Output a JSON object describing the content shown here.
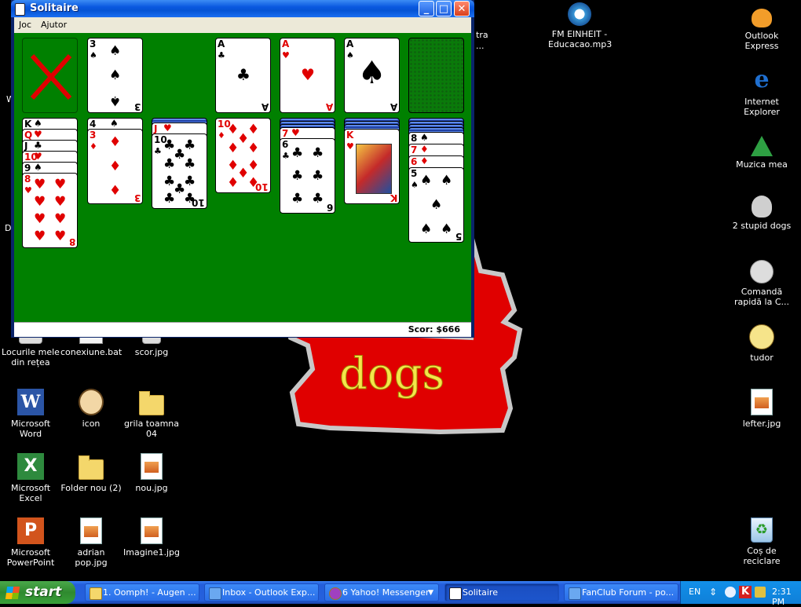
{
  "window": {
    "title": "Solitaire",
    "menu": [
      "Joc",
      "Ajutor"
    ],
    "status_score": "Scor: $666",
    "buttons": {
      "minimize": "_",
      "maximize": "□",
      "close": "✕"
    }
  },
  "game": {
    "stock": {
      "state": "empty",
      "mark": "red-x"
    },
    "waste_top": {
      "rank": "3",
      "suit": "♠"
    },
    "foundations": [
      {
        "rank": "A",
        "suit": "♣"
      },
      {
        "rank": "A",
        "suit": "♥"
      },
      {
        "rank": "A",
        "suit": "♠"
      },
      {
        "state": "empty"
      }
    ],
    "tableau": [
      {
        "face_down": 0,
        "face_up": [
          {
            "rank": "K",
            "suit": "♠"
          },
          {
            "rank": "Q",
            "suit": "♥"
          },
          {
            "rank": "J",
            "suit": "♣"
          },
          {
            "rank": "10",
            "suit": "♥"
          },
          {
            "rank": "9",
            "suit": "♠"
          },
          {
            "rank": "8",
            "suit": "♥"
          }
        ]
      },
      {
        "face_down": 0,
        "face_up": [
          {
            "rank": "4",
            "suit": "♠"
          },
          {
            "rank": "3",
            "suit": "♦"
          }
        ]
      },
      {
        "face_down": 1,
        "face_up": [
          {
            "rank": "J",
            "suit": "♥"
          },
          {
            "rank": "10",
            "suit": "♣"
          }
        ]
      },
      {
        "face_down": 0,
        "face_up": [
          {
            "rank": "10",
            "suit": "♦"
          }
        ]
      },
      {
        "face_down": 3,
        "face_up": [
          {
            "rank": "7",
            "suit": "♥"
          },
          {
            "rank": "6",
            "suit": "♣"
          }
        ]
      },
      {
        "face_down": 4,
        "face_up": [
          {
            "rank": "K",
            "suit": "♥"
          }
        ]
      },
      {
        "face_down": 4,
        "face_up": [
          {
            "rank": "8",
            "suit": "♠"
          },
          {
            "rank": "7",
            "suit": "♦"
          },
          {
            "rank": "6",
            "suit": "♦"
          },
          {
            "rank": "5",
            "suit": "♠"
          }
        ]
      }
    ]
  },
  "wallpaper": {
    "text": "dogs"
  },
  "desktop_icons": {
    "left": [
      {
        "label": "Locurile mele din rețea",
        "icon": "network-icon"
      },
      {
        "label": "conexiune.bat",
        "icon": "bat-file-icon"
      },
      {
        "label": "scor.jpg",
        "icon": "image-file-icon"
      },
      {
        "label": "Microsoft Word",
        "icon": "word-icon"
      },
      {
        "label": "icon",
        "icon": "person-icon"
      },
      {
        "label": "grila toamna 04",
        "icon": "folder-icon"
      },
      {
        "label": "Microsoft Excel",
        "icon": "excel-icon"
      },
      {
        "label": "Folder nou (2)",
        "icon": "folder-icon"
      },
      {
        "label": "nou.jpg",
        "icon": "image-file-icon"
      },
      {
        "label": "Microsoft PowerPoint",
        "icon": "powerpoint-icon"
      },
      {
        "label": "adrian pop.jpg",
        "icon": "image-file-icon"
      },
      {
        "label": "Imagine1.jpg",
        "icon": "image-file-icon"
      }
    ],
    "middle": [
      {
        "label": "FM EINHEIT - Educacao.mp3",
        "icon": "media-player-icon"
      }
    ],
    "right": [
      {
        "label": "Outlook Express",
        "icon": "outlook-icon"
      },
      {
        "label": "Internet Explorer",
        "icon": "internet-explorer-icon"
      },
      {
        "label": "Muzica mea",
        "icon": "music-folder-icon"
      },
      {
        "label": "2 stupid dogs",
        "icon": "dog-icon"
      },
      {
        "label": "Comandă rapidă la C...",
        "icon": "shortcut-icon"
      },
      {
        "label": "tudor",
        "icon": "person-icon"
      },
      {
        "label": "lefter.jpg",
        "icon": "image-file-icon"
      },
      {
        "label": "Coș de reciclare",
        "icon": "recycle-bin-icon"
      }
    ],
    "partial": [
      "tra",
      "...",
      "W",
      "D"
    ]
  },
  "taskbar": {
    "start": "start",
    "tasks": [
      {
        "label": "1. Oomph! - Augen ...",
        "active": false
      },
      {
        "label": "Inbox - Outlook Exp...",
        "active": false
      },
      {
        "label": "6 Yahoo! Messenger",
        "active": false
      },
      {
        "label": "Solitaire",
        "active": true
      },
      {
        "label": "FanClub Forum - po...",
        "active": false
      }
    ],
    "language": "EN",
    "clock": "2:31 PM"
  }
}
